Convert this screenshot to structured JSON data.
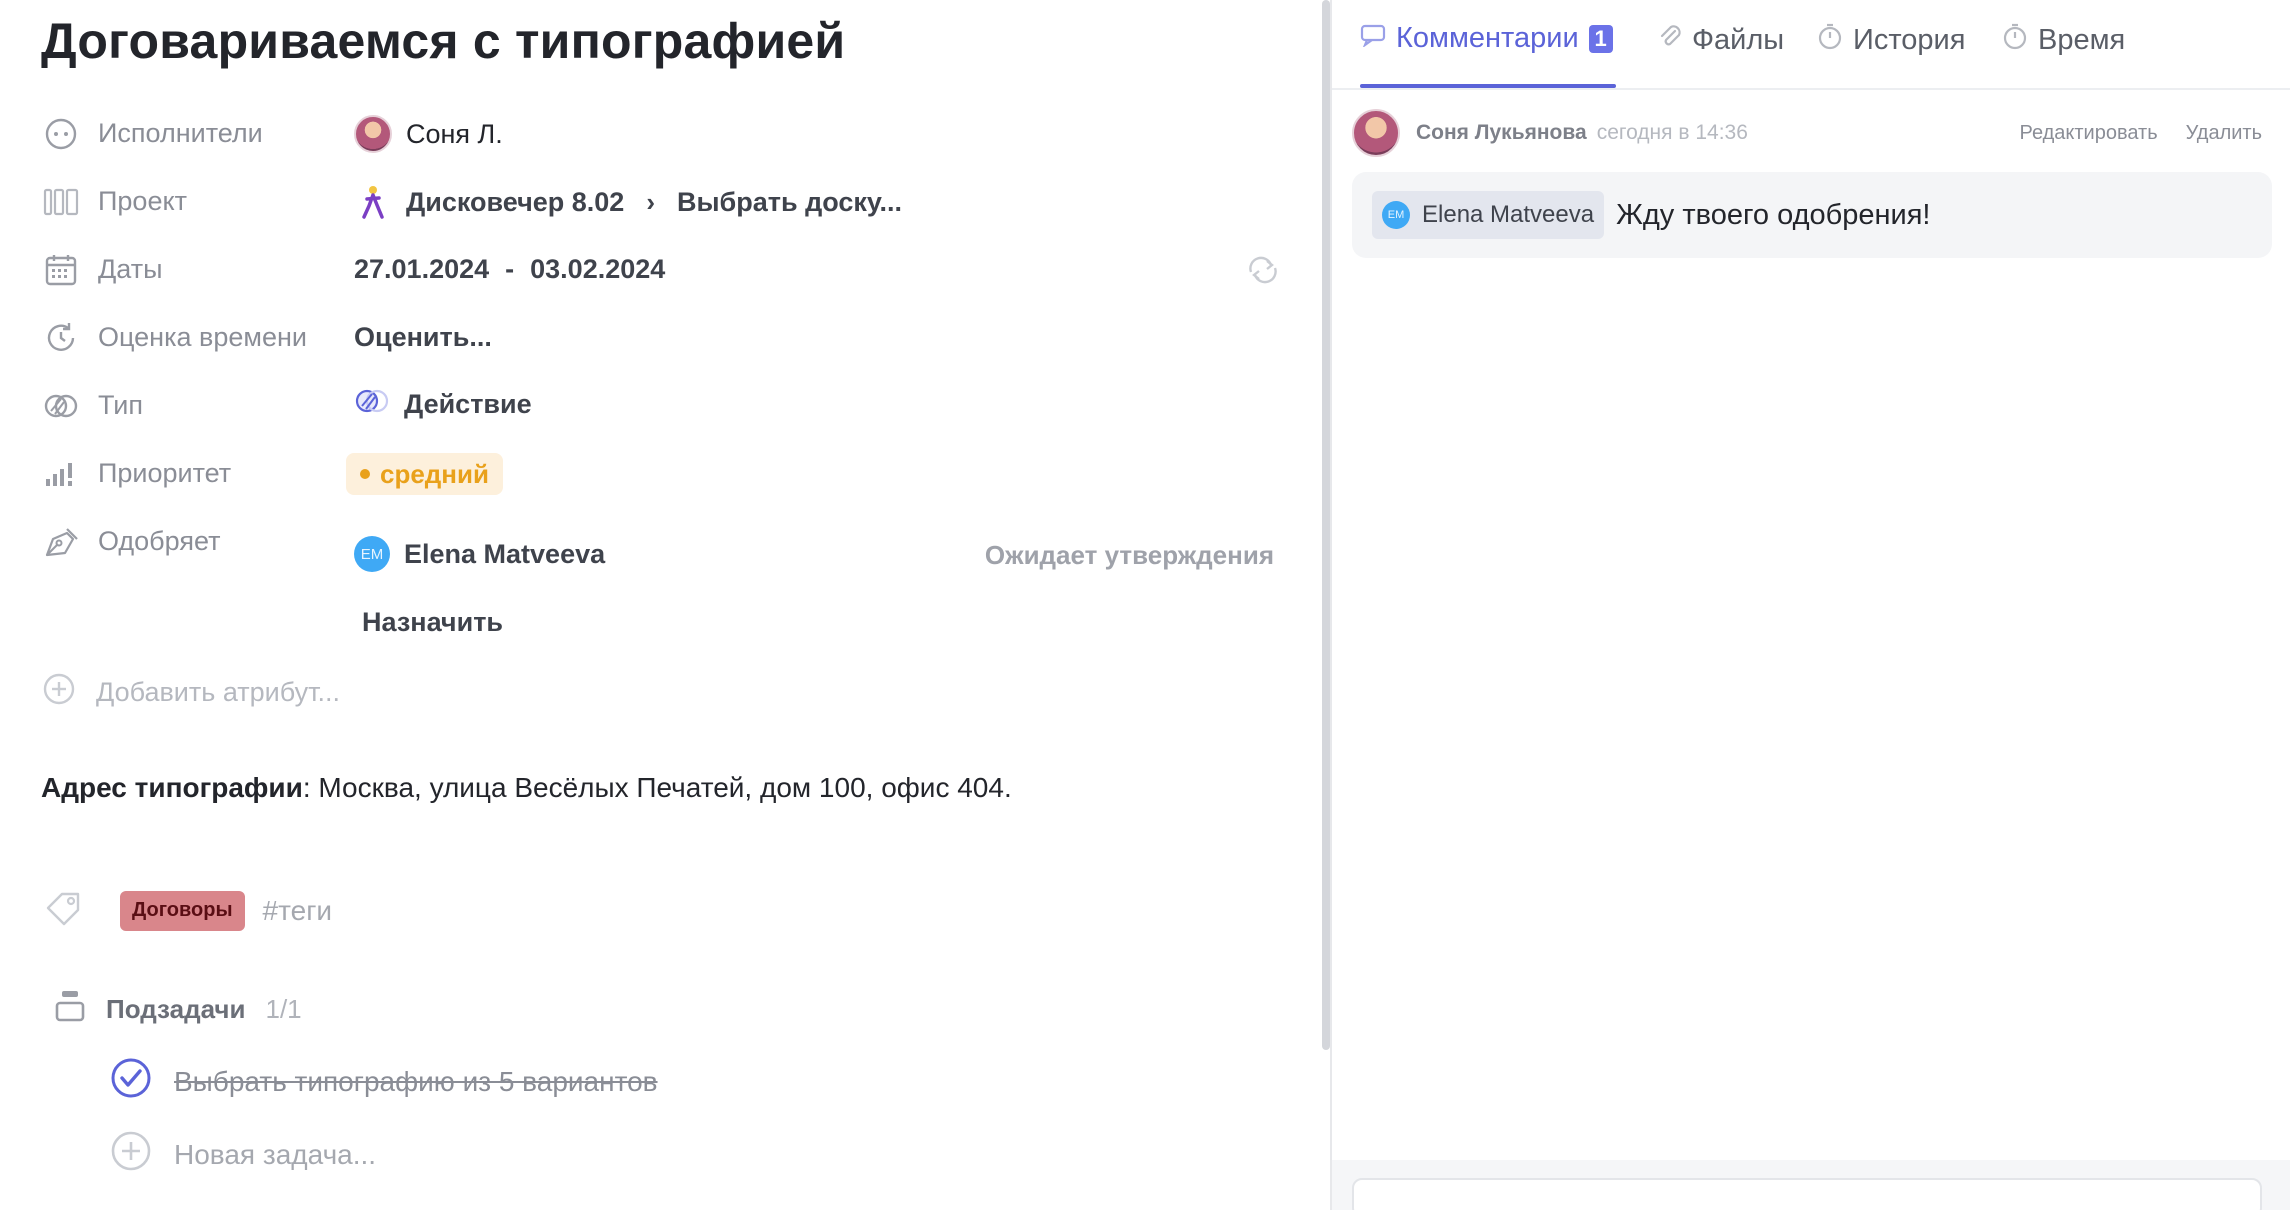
{
  "task": {
    "title": "Договариваемся с типографией"
  },
  "attributes": {
    "assignees_label": "Исполнители",
    "assignee_name": "Соня Л.",
    "project_label": "Проект",
    "project_name": "Дисковечер 8.02",
    "project_board": "Выбрать доску...",
    "dates_label": "Даты",
    "date_start": "27.01.2024",
    "date_separator": "-",
    "date_end": "03.02.2024",
    "estimate_label": "Оценка времени",
    "estimate_value": "Оценить...",
    "type_label": "Тип",
    "type_value": "Действие",
    "priority_label": "Приоритет",
    "priority_value": "средний",
    "approver_label": "Одобряет",
    "approver_initials": "EM",
    "approver_name": "Elena Matveeva",
    "approval_status": "Ожидает утверждения",
    "assign_label": "Назначить",
    "add_attribute": "Добавить атрибут..."
  },
  "description": {
    "bold": "Адрес типографии",
    "text": ": Москва, улица Весёлых Печатей, дом 100, офис 404."
  },
  "tags": {
    "chips": [
      "Договоры"
    ],
    "placeholder": "#теги"
  },
  "subtasks": {
    "label": "Подзадачи",
    "count": "1/1",
    "items": [
      {
        "title": "Выбрать типографию из 5 вариантов",
        "done": true
      }
    ],
    "new_placeholder": "Новая задача..."
  },
  "tabs": [
    {
      "label": "Комментарии",
      "badge": "1",
      "icon": "comment-icon",
      "active": true
    },
    {
      "label": "Файлы",
      "icon": "paperclip-icon",
      "active": false
    },
    {
      "label": "История",
      "icon": "stopwatch-icon",
      "active": false
    },
    {
      "label": "Время",
      "icon": "stopwatch-icon",
      "active": false
    }
  ],
  "comments": [
    {
      "author": "Соня Лукьянова",
      "time": "сегодня в 14:36",
      "edit_label": "Редактировать",
      "delete_label": "Удалить",
      "mention_initials": "EM",
      "mention_name": "Elena Matveeva",
      "text": "Жду твоего одобрения!"
    }
  ],
  "colors": {
    "accent": "#5b63d8",
    "priority_medium": "#e9a11b",
    "priority_bg": "#fdf0dc",
    "tag_contracts": "#d9868b",
    "avatar_em": "#3fa9f5"
  }
}
